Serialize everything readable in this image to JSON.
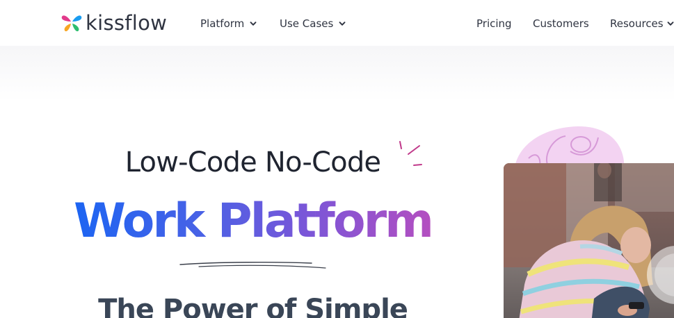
{
  "brand": {
    "name": "kissflow",
    "logo_icon": "kissflow-butterfly-icon",
    "logo_colors": [
      "#e23a8b",
      "#f7a623",
      "#1a9cf0",
      "#2dbd6e"
    ]
  },
  "nav": {
    "left_items": [
      {
        "label": "Platform",
        "has_dropdown": true,
        "icon": "chevron-down-icon"
      },
      {
        "label": "Use Cases",
        "has_dropdown": true,
        "icon": "chevron-down-icon"
      }
    ],
    "right_items": [
      {
        "label": "Pricing",
        "has_dropdown": false
      },
      {
        "label": "Customers",
        "has_dropdown": false
      },
      {
        "label": "Resources",
        "has_dropdown": true,
        "icon": "chevron-down-icon"
      }
    ]
  },
  "hero": {
    "heading_line1": "Low-Code No-Code",
    "heading_line2": "Work Platform",
    "subheading": "The Power of Simple",
    "decorations": [
      "sparkle-icon",
      "scribble-underline"
    ],
    "gradient_colors": [
      "#1c64f2",
      "#4862e6",
      "#7a56d8",
      "#b44fc0"
    ]
  },
  "media": {
    "type": "video-thumbnail",
    "icon": "play-button-icon",
    "blob_color": "#f3d3f2",
    "blob_line_color": "#d79ad8"
  }
}
